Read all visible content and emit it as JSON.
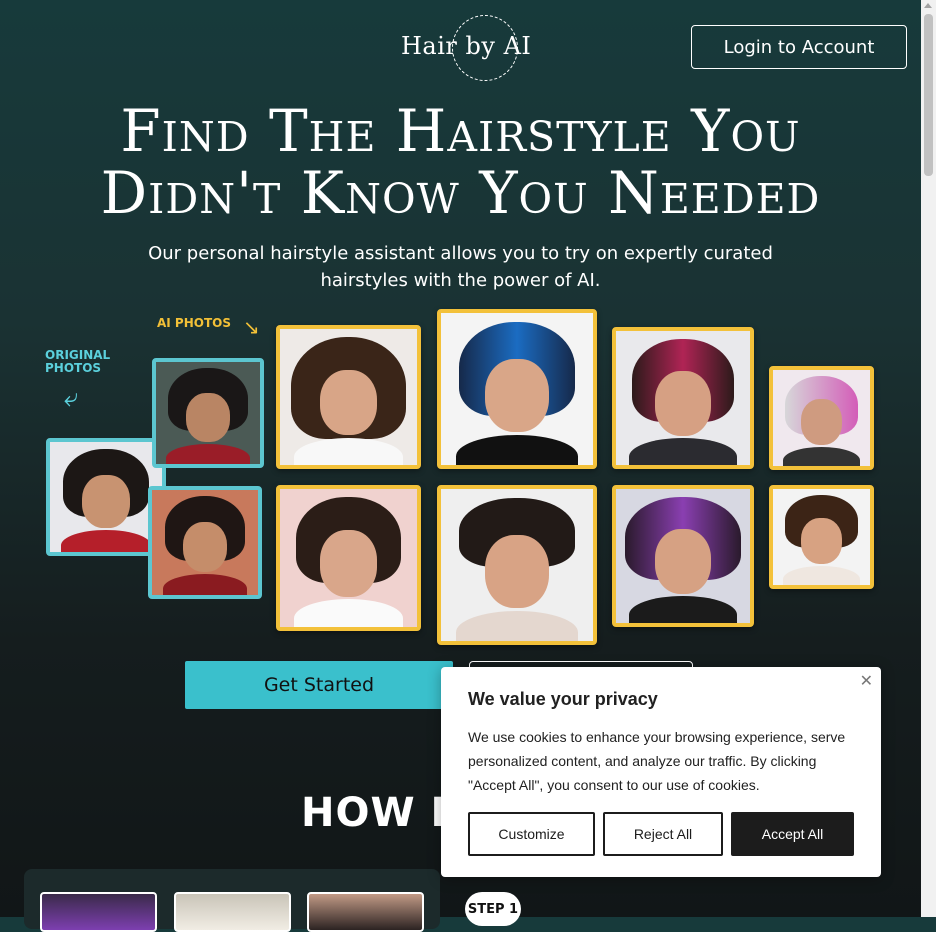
{
  "header": {
    "logo_text": "Hair by AI",
    "login_label": "Login to Account"
  },
  "hero": {
    "title_line1": "Find The Hairstyle You",
    "title_line2": "Didn't Know You Needed",
    "subtitle": "Our personal hairstyle assistant allows you to try on expertly curated hairstyles with the power of AI.",
    "collage": {
      "original_label_line1": "ORIGINAL",
      "original_label_line2": "PHOTOS",
      "ai_label": "AI PHOTOS"
    },
    "get_started_label": "Get Started",
    "secondary_label": ""
  },
  "how_it_works": {
    "title_visible": "HOW IT",
    "step_badge": "STEP 1"
  },
  "cookie_banner": {
    "title": "We value your privacy",
    "message": "We use cookies to enhance your browsing experience, serve personalized content, and analyze our traffic. By clicking \"Accept All\", you consent to our use of cookies.",
    "customize_label": "Customize",
    "reject_label": "Reject All",
    "accept_label": "Accept All",
    "close_icon": "close-icon"
  },
  "colors": {
    "accent_teal": "#3ac0cc",
    "original_border": "#5cc6d0",
    "ai_border": "#f3c13a"
  }
}
